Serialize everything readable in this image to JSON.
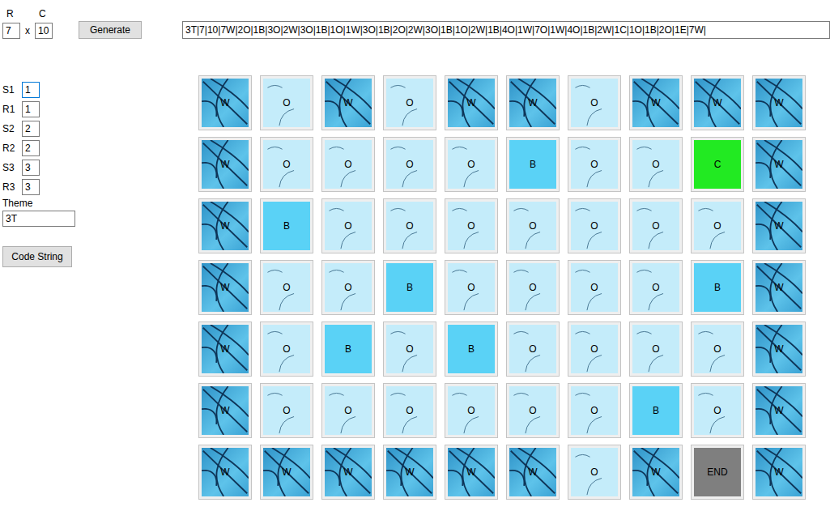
{
  "size_fields": [
    {
      "label": "R",
      "value": "7"
    },
    {
      "label": "C",
      "value": "10"
    }
  ],
  "separator": "x",
  "generate_button": "Generate",
  "code_field": {
    "value": "3T|7|10|7W|2O|1B|3O|2W|3O|1B|1O|1W|3O|1B|2O|2W|3O|1B|1O|2W|1B|4O|1W|7O|1W|4O|1B|2W|1C|1O|1B|2O|1E|7W|"
  },
  "params": [
    {
      "label": "S1",
      "value": "1",
      "focused": true
    },
    {
      "label": "R1",
      "value": "1",
      "focused": false
    },
    {
      "label": "S2",
      "value": "2",
      "focused": false
    },
    {
      "label": "R2",
      "value": "2",
      "focused": false
    },
    {
      "label": "S3",
      "value": "3",
      "focused": false
    },
    {
      "label": "R3",
      "value": "3",
      "focused": false
    }
  ],
  "theme": {
    "label": "Theme",
    "value": "3T"
  },
  "code_string_button": "Code String",
  "grid": {
    "rows": [
      [
        {
          "label": "W",
          "kind": "wall"
        },
        {
          "label": "O",
          "kind": "open"
        },
        {
          "label": "W",
          "kind": "wall"
        },
        {
          "label": "O",
          "kind": "open"
        },
        {
          "label": "W",
          "kind": "wall"
        },
        {
          "label": "W",
          "kind": "wall"
        },
        {
          "label": "O",
          "kind": "open"
        },
        {
          "label": "W",
          "kind": "wall"
        },
        {
          "label": "W",
          "kind": "wall"
        },
        {
          "label": "W",
          "kind": "wall"
        }
      ],
      [
        {
          "label": "W",
          "kind": "wall"
        },
        {
          "label": "O",
          "kind": "open"
        },
        {
          "label": "O",
          "kind": "open"
        },
        {
          "label": "O",
          "kind": "open"
        },
        {
          "label": "O",
          "kind": "open"
        },
        {
          "label": "B",
          "kind": "block"
        },
        {
          "label": "O",
          "kind": "open"
        },
        {
          "label": "O",
          "kind": "open"
        },
        {
          "label": "C",
          "kind": "start"
        },
        {
          "label": "W",
          "kind": "wall"
        }
      ],
      [
        {
          "label": "W",
          "kind": "wall"
        },
        {
          "label": "B",
          "kind": "block"
        },
        {
          "label": "O",
          "kind": "open"
        },
        {
          "label": "O",
          "kind": "open"
        },
        {
          "label": "O",
          "kind": "open"
        },
        {
          "label": "O",
          "kind": "open"
        },
        {
          "label": "O",
          "kind": "open"
        },
        {
          "label": "O",
          "kind": "open"
        },
        {
          "label": "O",
          "kind": "open"
        },
        {
          "label": "W",
          "kind": "wall"
        }
      ],
      [
        {
          "label": "W",
          "kind": "wall"
        },
        {
          "label": "O",
          "kind": "open"
        },
        {
          "label": "O",
          "kind": "open"
        },
        {
          "label": "B",
          "kind": "block"
        },
        {
          "label": "O",
          "kind": "open"
        },
        {
          "label": "O",
          "kind": "open"
        },
        {
          "label": "O",
          "kind": "open"
        },
        {
          "label": "O",
          "kind": "open"
        },
        {
          "label": "B",
          "kind": "block"
        },
        {
          "label": "W",
          "kind": "wall"
        }
      ],
      [
        {
          "label": "W",
          "kind": "wall"
        },
        {
          "label": "O",
          "kind": "open"
        },
        {
          "label": "B",
          "kind": "block"
        },
        {
          "label": "O",
          "kind": "open"
        },
        {
          "label": "B",
          "kind": "block"
        },
        {
          "label": "O",
          "kind": "open"
        },
        {
          "label": "O",
          "kind": "open"
        },
        {
          "label": "O",
          "kind": "open"
        },
        {
          "label": "O",
          "kind": "open"
        },
        {
          "label": "W",
          "kind": "wall"
        }
      ],
      [
        {
          "label": "W",
          "kind": "wall"
        },
        {
          "label": "O",
          "kind": "open"
        },
        {
          "label": "O",
          "kind": "open"
        },
        {
          "label": "O",
          "kind": "open"
        },
        {
          "label": "O",
          "kind": "open"
        },
        {
          "label": "O",
          "kind": "open"
        },
        {
          "label": "O",
          "kind": "open"
        },
        {
          "label": "B",
          "kind": "block"
        },
        {
          "label": "O",
          "kind": "open"
        },
        {
          "label": "W",
          "kind": "wall"
        }
      ],
      [
        {
          "label": "W",
          "kind": "wall"
        },
        {
          "label": "W",
          "kind": "wall"
        },
        {
          "label": "W",
          "kind": "wall"
        },
        {
          "label": "W",
          "kind": "wall"
        },
        {
          "label": "W",
          "kind": "wall"
        },
        {
          "label": "W",
          "kind": "wall"
        },
        {
          "label": "O",
          "kind": "open"
        },
        {
          "label": "W",
          "kind": "wall"
        },
        {
          "label": "END",
          "kind": "end"
        },
        {
          "label": "W",
          "kind": "wall"
        }
      ]
    ]
  }
}
